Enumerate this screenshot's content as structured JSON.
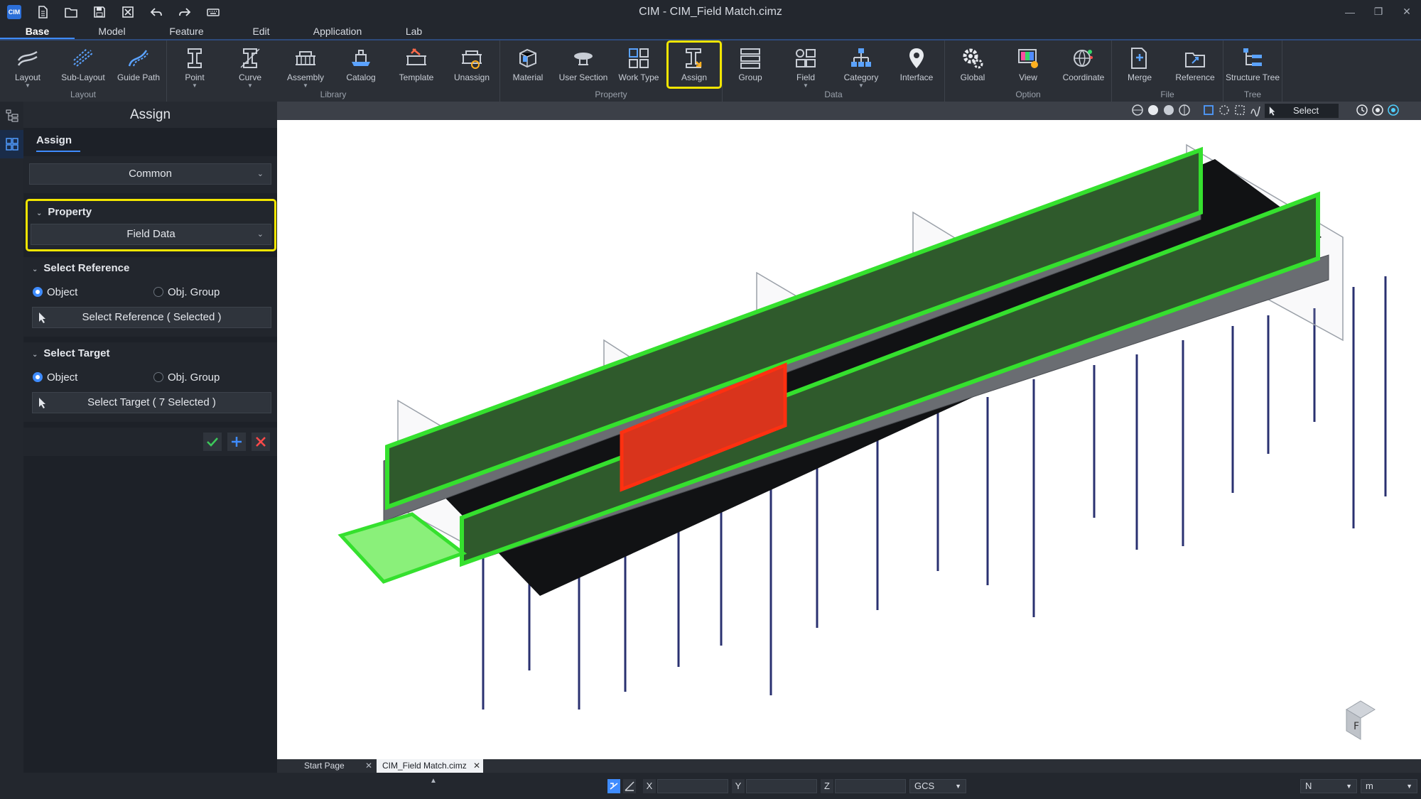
{
  "window": {
    "title": "CIM - CIM_Field Match.cimz",
    "app_logo": "CIM"
  },
  "menu_tabs": [
    "Base",
    "Model",
    "Feature",
    "Edit",
    "Application",
    "Lab"
  ],
  "ribbon": {
    "groups": [
      {
        "label": "Layout",
        "buttons": [
          {
            "label": "Layout",
            "icon": "layout-icon"
          },
          {
            "label": "Sub-Layout",
            "icon": "sub-layout-icon"
          },
          {
            "label": "Guide Path",
            "icon": "guide-path-icon"
          }
        ]
      },
      {
        "label": "Library",
        "buttons": [
          {
            "label": "Point",
            "icon": "point-icon"
          },
          {
            "label": "Curve",
            "icon": "curve-icon"
          },
          {
            "label": "Assembly",
            "icon": "assembly-icon"
          },
          {
            "label": "Catalog",
            "icon": "catalog-icon"
          },
          {
            "label": "Template",
            "icon": "template-icon"
          },
          {
            "label": "Unassign",
            "icon": "unassign-icon"
          }
        ]
      },
      {
        "label": "Property",
        "buttons": [
          {
            "label": "Material",
            "icon": "material-icon"
          },
          {
            "label": "User Section",
            "icon": "user-section-icon"
          },
          {
            "label": "Work Type",
            "icon": "work-type-icon"
          },
          {
            "label": "Assign",
            "icon": "assign-icon"
          }
        ]
      },
      {
        "label": "Data",
        "buttons": [
          {
            "label": "Group",
            "icon": "group-icon"
          },
          {
            "label": "Field",
            "icon": "field-icon"
          },
          {
            "label": "Category",
            "icon": "category-icon"
          },
          {
            "label": "Interface",
            "icon": "interface-icon"
          }
        ]
      },
      {
        "label": "Option",
        "buttons": [
          {
            "label": "Global",
            "icon": "global-icon"
          },
          {
            "label": "View",
            "icon": "view-icon"
          },
          {
            "label": "Coordinate",
            "icon": "coordinate-icon"
          }
        ]
      },
      {
        "label": "File",
        "buttons": [
          {
            "label": "Merge",
            "icon": "merge-icon"
          },
          {
            "label": "Reference",
            "icon": "reference-icon"
          }
        ]
      },
      {
        "label": "Tree",
        "buttons": [
          {
            "label": "Structure Tree",
            "icon": "structure-tree-icon"
          }
        ]
      }
    ]
  },
  "panel": {
    "title": "Assign",
    "tab": "Assign",
    "common_select": "Common",
    "property": {
      "header": "Property",
      "value": "Field Data"
    },
    "select_reference": {
      "header": "Select Reference",
      "opt_object": "Object",
      "opt_group": "Obj. Group",
      "button": "Select Reference ( Selected )"
    },
    "select_target": {
      "header": "Select Target",
      "opt_object": "Object",
      "opt_group": "Obj. Group",
      "button": "Select Target ( 7 Selected )"
    }
  },
  "viewport": {
    "select_mode": "Select"
  },
  "doc_tabs": [
    "Start Page",
    "CIM_Field Match.cimz"
  ],
  "status": {
    "x": "X",
    "y": "Y",
    "z": "Z",
    "coord_system": "GCS",
    "north": "N",
    "unit": "m"
  },
  "colors": {
    "accent": "#3f8cff",
    "highlight": "#f2e500",
    "model_green": "#35e02e",
    "model_red": "#ff3010"
  }
}
